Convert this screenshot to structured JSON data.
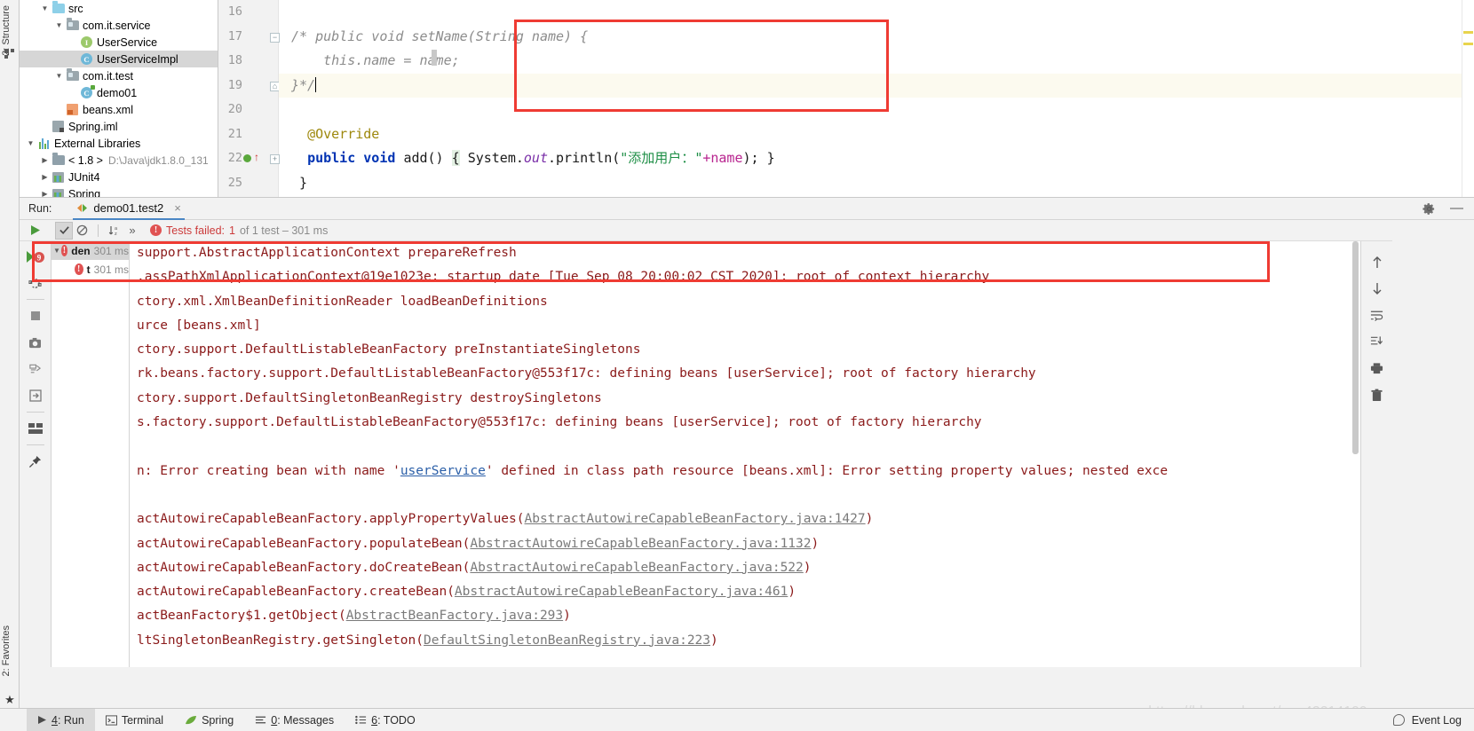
{
  "rails": {
    "structure_label": "2: Structure",
    "favorites_label": "2: Favorites"
  },
  "project_tree": {
    "items": [
      {
        "label": "src",
        "icon": "folder-icon",
        "arrow": "▼",
        "indent": 1,
        "type": "folder"
      },
      {
        "label": "com.it.service",
        "icon": "package-icon",
        "arrow": "▼",
        "indent": 2,
        "type": "package"
      },
      {
        "label": "UserService",
        "icon": "interface-icon",
        "arrow": "",
        "indent": 3,
        "type": "interface",
        "glyph": "I"
      },
      {
        "label": "UserServiceImpl",
        "icon": "class-icon",
        "arrow": "",
        "indent": 3,
        "type": "class",
        "glyph": "C",
        "selected": true
      },
      {
        "label": "com.it.test",
        "icon": "package-icon",
        "arrow": "▼",
        "indent": 2,
        "type": "package"
      },
      {
        "label": "demo01",
        "icon": "test-class-icon",
        "arrow": "",
        "indent": 3,
        "type": "testclass",
        "glyph": "C"
      },
      {
        "label": "beans.xml",
        "icon": "xml-file-icon",
        "arrow": "",
        "indent": 2,
        "type": "xml"
      },
      {
        "label": "Spring.iml",
        "icon": "iml-file-icon",
        "arrow": "",
        "indent": 1,
        "type": "iml"
      },
      {
        "label": "External Libraries",
        "icon": "libraries-icon",
        "arrow": "▼",
        "indent": 0,
        "type": "libs"
      },
      {
        "label": "< 1.8 >",
        "sublabel": "D:\\Java\\jdk1.8.0_131",
        "icon": "jdk-icon",
        "arrow": "▶",
        "indent": 1,
        "type": "jdk"
      },
      {
        "label": "JUnit4",
        "icon": "library-icon",
        "arrow": "▶",
        "indent": 1,
        "type": "lib"
      },
      {
        "label": "Spring",
        "icon": "library-icon",
        "arrow": "▶",
        "indent": 1,
        "type": "lib"
      }
    ]
  },
  "editor": {
    "lines": [
      {
        "num": "16",
        "fold": "",
        "text": ""
      },
      {
        "num": "17",
        "fold": "−",
        "text": "/* public void setName(String name) {",
        "style": "comment"
      },
      {
        "num": "18",
        "fold": "",
        "text": "        this.name = name;",
        "style": "comment"
      },
      {
        "num": "19",
        "fold": "⌂",
        "text": "    }*/",
        "style": "comment",
        "current": true
      },
      {
        "num": "20",
        "fold": "",
        "text": ""
      },
      {
        "num": "21",
        "fold": "",
        "text": "    @Override",
        "style": "annotation"
      },
      {
        "num": "22",
        "fold": "+",
        "text": "    public void add() { System.out.println(\"添加用户：\"+name); }",
        "style": "code",
        "breakpoint": true
      },
      {
        "num": "25",
        "fold": "",
        "text": "}",
        "style": "code"
      }
    ],
    "code_tokens": {
      "comment_l17": "/* public void setName(String name) {",
      "comment_l18": "this.name = name;",
      "comment_l19": "}*/",
      "annotation": "@Override",
      "kw_public": "public",
      "kw_void": "void",
      "method_add": "add()",
      "brace_open": "{",
      "sys": "System.",
      "out": "out",
      "dot_println": ".println(",
      "string_literal": "\"添加用户：\"",
      "plus": "+",
      "field_name": "name",
      "close_paren": ");",
      "brace_close": "}",
      "last_brace": "}"
    }
  },
  "run_panel": {
    "run_label": "Run:",
    "tab_name": "demo01.test2",
    "tab_close": "×",
    "gear_icon": "settings-gear-icon",
    "minimize_icon": "minimize-icon",
    "toolbar": {
      "rerun_icon": "run-icon",
      "show_passed_icon": "check-icon",
      "show_ignored_icon": "no-entry-icon",
      "sort_alpha_icon": "sort-alphabetically-icon",
      "more_icon": "»",
      "status_prefix": "Tests failed:",
      "status_count": "1",
      "status_suffix": "of 1 test – 301 ms"
    },
    "vertical_toolbar": [
      {
        "icon": "rerun-failed-icon",
        "badge": "9"
      },
      {
        "icon": "rerun-tests-icon"
      },
      {
        "icon": "stop-icon"
      },
      {
        "icon": "export-snapshot-icon"
      },
      {
        "icon": "import-tests-icon"
      },
      {
        "icon": "open-console-icon"
      },
      {
        "icon": "layout-icon"
      },
      {
        "icon": "pin-tab-icon"
      }
    ],
    "test_tree": [
      {
        "label": "den",
        "time": "301 ms",
        "arrow": "▼",
        "indent": 0,
        "selected": true,
        "status": "failed"
      },
      {
        "label": "t",
        "time": "301 ms",
        "arrow": "",
        "indent": 1,
        "selected": false,
        "status": "failed"
      }
    ],
    "console_right_icons": [
      {
        "icon": "arrow-up-icon"
      },
      {
        "icon": "arrow-down-icon"
      },
      {
        "icon": "soft-wrap-icon"
      },
      {
        "icon": "scroll-to-end-icon"
      },
      {
        "icon": "print-icon"
      },
      {
        "icon": "trash-icon"
      }
    ]
  },
  "console": {
    "lines": [
      {
        "text": "support.AbstractApplicationContext prepareRefresh"
      },
      {
        "text": ".assPathXmlApplicationContext@19e1023e: startup date [Tue Sep 08 20:00:02 CST 2020]; root of context hierarchy"
      },
      {
        "text": "ctory.xml.XmlBeanDefinitionReader loadBeanDefinitions"
      },
      {
        "text": "urce [beans.xml]"
      },
      {
        "text": "ctory.support.DefaultListableBeanFactory preInstantiateSingletons"
      },
      {
        "text": "rk.beans.factory.support.DefaultListableBeanFactory@553f17c: defining beans [userService]; root of factory hierarchy"
      },
      {
        "text": "ctory.support.DefaultSingletonBeanRegistry destroySingletons"
      },
      {
        "text": "s.factory.support.DefaultListableBeanFactory@553f17c: defining beans [userService]; root of factory hierarchy"
      },
      {
        "text": ""
      },
      {
        "text": "ERROR_LINE"
      },
      {
        "text": ""
      },
      {
        "text": "STACK_1"
      },
      {
        "text": "STACK_2"
      },
      {
        "text": "STACK_3"
      },
      {
        "text": "STACK_4"
      },
      {
        "text": "STACK_5"
      },
      {
        "text": "STACK_6"
      }
    ],
    "error_line": {
      "prefix": "n: ",
      "part1": "Error creating bean with name '",
      "link": "userService",
      "part2": "' defined in class path resource [beans.xml]: Error setting property values; nested exce"
    },
    "stack": [
      {
        "method": "actAutowireCapableBeanFactory.applyPropertyValues(",
        "link": "AbstractAutowireCapableBeanFactory.java:1427",
        "suffix": ")"
      },
      {
        "method": "actAutowireCapableBeanFactory.populateBean(",
        "link": "AbstractAutowireCapableBeanFactory.java:1132",
        "suffix": ")"
      },
      {
        "method": "actAutowireCapableBeanFactory.doCreateBean(",
        "link": "AbstractAutowireCapableBeanFactory.java:522",
        "suffix": ")"
      },
      {
        "method": "actAutowireCapableBeanFactory.createBean(",
        "link": "AbstractAutowireCapableBeanFactory.java:461",
        "suffix": ")"
      },
      {
        "method": "actBeanFactory$1.getObject(",
        "link": "AbstractBeanFactory.java:293",
        "suffix": ")"
      },
      {
        "method": "ltSingletonBeanRegistry.getSingleton(",
        "link": "DefaultSingletonBeanRegistry.java:223",
        "suffix": ")"
      }
    ]
  },
  "statusbar": {
    "items": [
      {
        "label": "4: Run",
        "icon": "run-play-icon",
        "accesskey": "4",
        "active": true
      },
      {
        "label": "Terminal",
        "icon": "terminal-icon",
        "active": false
      },
      {
        "label": "Spring",
        "icon": "spring-leaf-icon",
        "active": false
      },
      {
        "label": "0: Messages",
        "icon": "messages-icon",
        "accesskey": "0",
        "active": false
      },
      {
        "label": "6: TODO",
        "icon": "todo-icon",
        "accesskey": "6",
        "active": false
      }
    ],
    "event_log": "Event Log",
    "event_log_icon": "event-log-icon"
  },
  "watermark": "https://blog.csdn.net/qq_43214199",
  "colors": {
    "accent_red": "#ef3b33",
    "console_text": "#8b1a1a",
    "link_blue": "#2b5fa8",
    "tab_underline": "#4a86c5",
    "selection_grey": "#d6d6d6"
  }
}
